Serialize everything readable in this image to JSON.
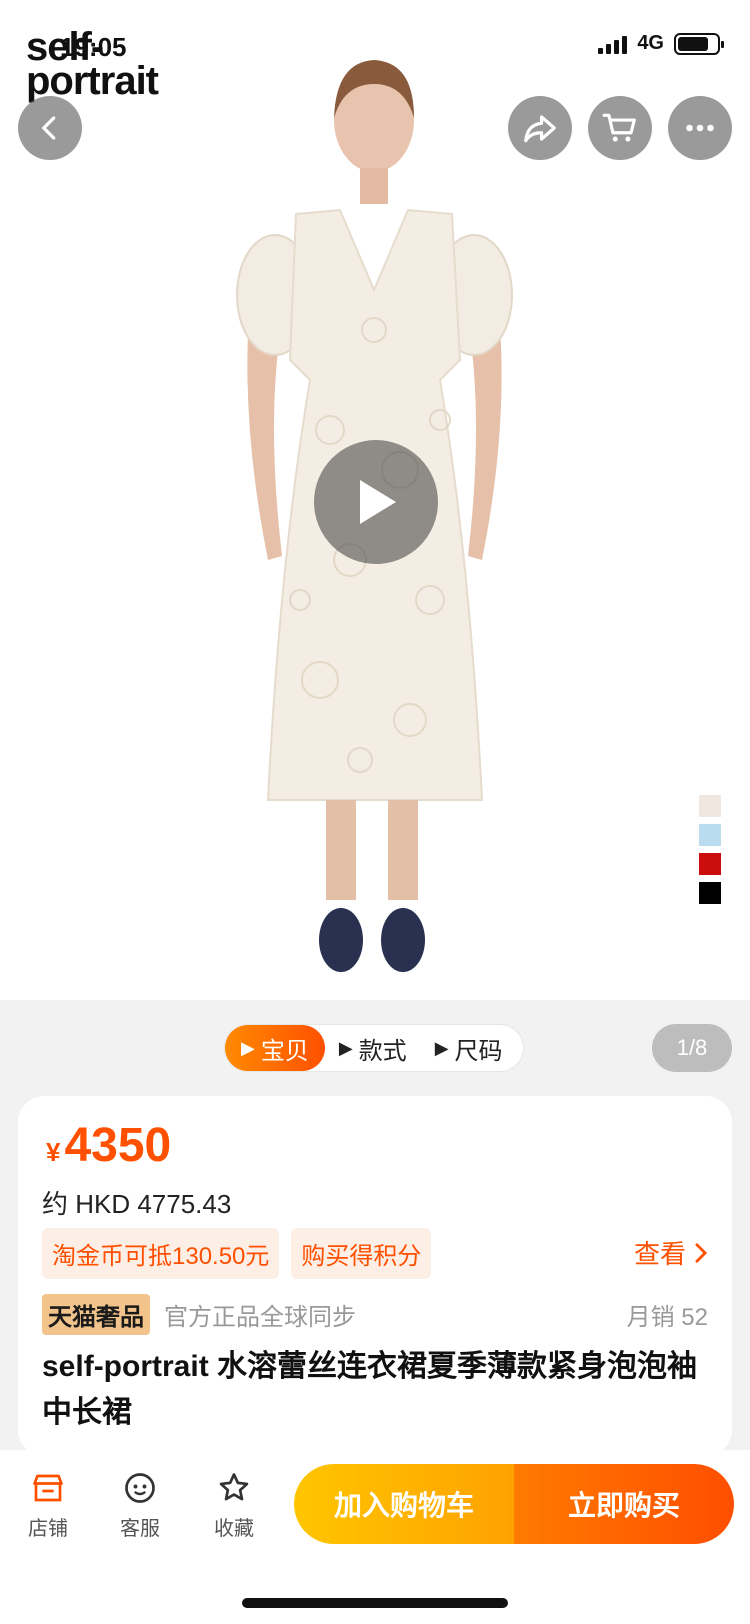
{
  "status_bar": {
    "time": "19:05",
    "network": "4G",
    "battery_level": 0.8
  },
  "brand_logo": {
    "line1": "self-",
    "line2": "portrait"
  },
  "header_buttons": {
    "back": "back-arrow-icon",
    "share": "share-icon",
    "cart": "cart-icon",
    "more": "more-icon"
  },
  "media": {
    "play_icon": "play-icon",
    "color_swatches": [
      "#efe7e0",
      "#b9dcee",
      "#cc0d0d",
      "#000000"
    ]
  },
  "tabs": [
    {
      "label": "宝贝",
      "active": true
    },
    {
      "label": "款式",
      "active": false
    },
    {
      "label": "尺码",
      "active": false
    }
  ],
  "page_indicator": "1/8",
  "price": {
    "symbol": "¥",
    "value": "4350",
    "converted": "约 HKD 4775.43"
  },
  "promos": [
    "淘金币可抵130.50元",
    "购买得积分"
  ],
  "view_link": "查看",
  "meta": {
    "badge": "天猫奢品",
    "official": "官方正品全球同步",
    "monthly_sales": "月销 52"
  },
  "product_title": "self-portrait 水溶蕾丝连衣裙夏季薄款紧身泡泡袖中长裙",
  "bottom_bar": {
    "shop": "店铺",
    "service": "客服",
    "favorite": "收藏",
    "add_to_cart": "加入购物车",
    "buy_now": "立即购买"
  },
  "colors": {
    "accent": "#ff5000",
    "cta_yellow": "#ffc500",
    "badge_gold": "#f2c48b"
  }
}
